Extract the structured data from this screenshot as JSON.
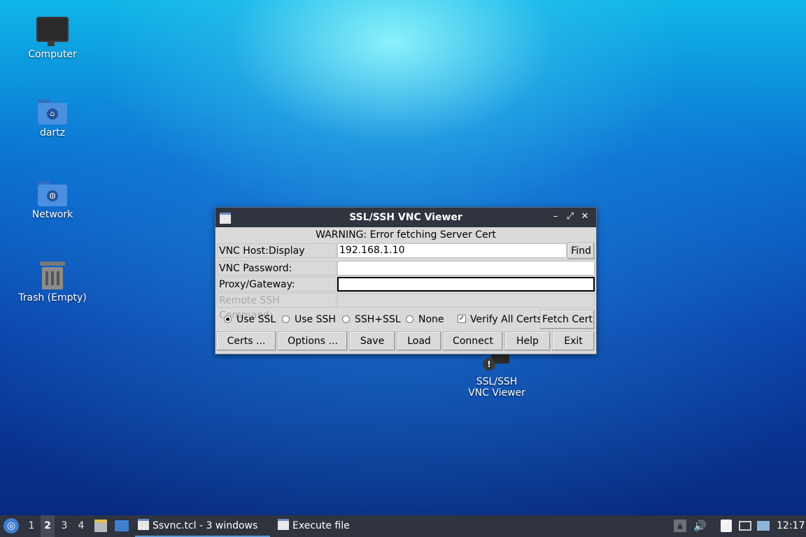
{
  "desktop": {
    "icons": [
      {
        "label": "Computer"
      },
      {
        "label": "dartz"
      },
      {
        "label": "Network"
      },
      {
        "label": "Trash (Empty)"
      },
      {
        "label": "SSL/SSH VNC Viewer"
      }
    ]
  },
  "window": {
    "title": "SSL/SSH VNC Viewer",
    "warning": "WARNING: Error fetching Server Cert",
    "fields": {
      "host_label": "VNC Host:Display",
      "host_value": "192.168.1.10",
      "find_label": "Find",
      "password_label": "VNC Password:",
      "password_value": "",
      "proxy_label": "Proxy/Gateway:",
      "proxy_value": "",
      "ssh_cmd_label": "Remote SSH Command:",
      "ssh_cmd_value": ""
    },
    "modes": [
      {
        "label": "Use SSL",
        "selected": true
      },
      {
        "label": "Use SSH",
        "selected": false
      },
      {
        "label": "SSH+SSL",
        "selected": false
      },
      {
        "label": "None",
        "selected": false
      }
    ],
    "verify_all_certs": {
      "label": "Verify All Certs",
      "checked": true
    },
    "fetch_cert_label": "Fetch Cert",
    "buttons": [
      "Certs ...",
      "Options ...",
      "Save",
      "Load",
      "Connect",
      "Help",
      "Exit"
    ]
  },
  "taskbar": {
    "workspaces": [
      "1",
      "2",
      "3",
      "4"
    ],
    "current_workspace": "2",
    "tasks": [
      {
        "label": "Ssvnc.tcl - 3 windows",
        "active": true
      },
      {
        "label": "Execute file",
        "active": false
      }
    ],
    "clock": "12:17"
  },
  "colors": {
    "taskbar_bg": "#2f343f",
    "titlebar_bg": "#2f343f",
    "dialog_bg": "#d9d9d9"
  }
}
